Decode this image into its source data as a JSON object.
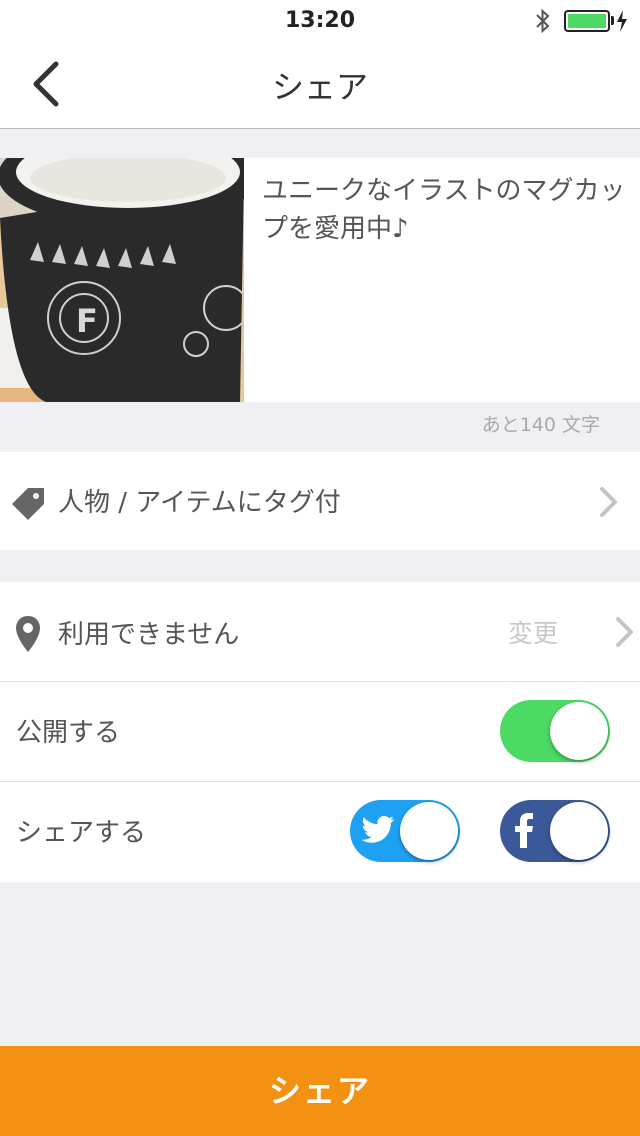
{
  "status_bar": {
    "time": "13:20",
    "battery_color": "#4cd964"
  },
  "nav": {
    "title": "シェア",
    "back_icon": "chevron-left-icon"
  },
  "post": {
    "photo": "mug-photo",
    "text": "ユニークなイラストのマグカップを愛用中♪",
    "remaining": "あと140 文字"
  },
  "tag_row": {
    "icon": "tag-icon",
    "label": "人物 / アイテムにタグ付"
  },
  "location_row": {
    "icon": "location-pin-icon",
    "label": "利用できません",
    "change_label": "変更"
  },
  "public_row": {
    "label": "公開する",
    "toggle_on": true,
    "toggle_color": "#4cd964"
  },
  "share_row": {
    "label": "シェアする",
    "twitter": {
      "icon": "twitter-icon",
      "on": true,
      "color": "#1ea1f2"
    },
    "facebook": {
      "icon": "facebook-icon",
      "on": true,
      "color": "#3b5998"
    }
  },
  "share_button": {
    "label": "シェア",
    "color": "#f39212"
  }
}
